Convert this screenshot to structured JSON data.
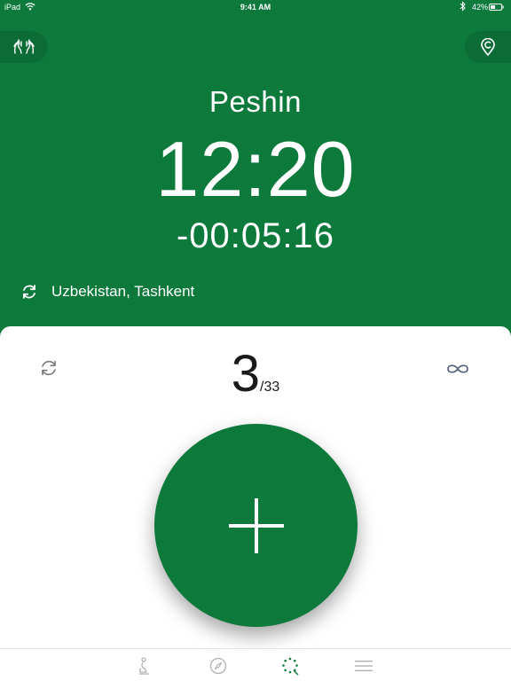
{
  "status_bar": {
    "device": "iPad",
    "time": "9:41 AM",
    "battery": "42%"
  },
  "header": {
    "left_icon": "praying-hands-icon",
    "right_icon": "location-pin-icon"
  },
  "prayer": {
    "name": "Peshin",
    "time": "12:20",
    "countdown": "-00:05:16"
  },
  "location": {
    "icon": "refresh-icon",
    "text": "Uzbekistan, Tashkent"
  },
  "tasbih": {
    "count": "3",
    "separator": "/",
    "target": "33",
    "reset_icon": "reset-icon",
    "mode_icon": "infinity-icon",
    "add_icon": "plus-icon"
  },
  "tabs": [
    {
      "icon": "prayer-mat-icon",
      "active": false
    },
    {
      "icon": "compass-icon",
      "active": false
    },
    {
      "icon": "tasbih-beads-icon",
      "active": true
    },
    {
      "icon": "menu-icon",
      "active": false
    }
  ],
  "colors": {
    "primary": "#0d7a3c",
    "inactive_icon": "#b0b0b0",
    "text_dark": "#1a1a1a"
  }
}
